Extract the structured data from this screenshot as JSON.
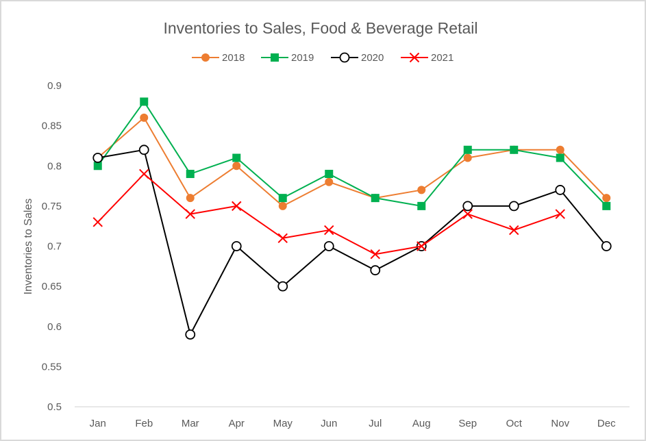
{
  "chart_data": {
    "type": "line",
    "title": "Inventories to Sales, Food & Beverage Retail",
    "xlabel": "",
    "ylabel": "Inventories to Sales",
    "categories": [
      "Jan",
      "Feb",
      "Mar",
      "Apr",
      "May",
      "Jun",
      "Jul",
      "Aug",
      "Sep",
      "Oct",
      "Nov",
      "Dec"
    ],
    "ylim": [
      0.5,
      0.9
    ],
    "yticks": [
      0.5,
      0.55,
      0.6,
      0.65,
      0.7,
      0.75,
      0.8,
      0.85,
      0.9
    ],
    "ytick_labels": [
      "0.5",
      "0.55",
      "0.6",
      "0.65",
      "0.7",
      "0.75",
      "0.8",
      "0.85",
      "0.9"
    ],
    "grid": false,
    "legend_position": "top-center",
    "series": [
      {
        "name": "2018",
        "color": "#ed7d31",
        "marker": "circle",
        "values": [
          0.81,
          0.86,
          0.76,
          0.8,
          0.75,
          0.78,
          0.76,
          0.77,
          0.81,
          0.82,
          0.82,
          0.76
        ]
      },
      {
        "name": "2019",
        "color": "#00b050",
        "marker": "square",
        "values": [
          0.8,
          0.88,
          0.79,
          0.81,
          0.76,
          0.79,
          0.76,
          0.75,
          0.82,
          0.82,
          0.81,
          0.75
        ]
      },
      {
        "name": "2020",
        "color": "#000000",
        "marker": "open-circle",
        "values": [
          0.81,
          0.82,
          0.59,
          0.7,
          0.65,
          0.7,
          0.67,
          0.7,
          0.75,
          0.75,
          0.77,
          0.7
        ]
      },
      {
        "name": "2021",
        "color": "#ff0000",
        "marker": "x",
        "values": [
          0.73,
          0.79,
          0.74,
          0.75,
          0.71,
          0.72,
          0.69,
          0.7,
          0.74,
          0.72,
          0.74,
          null
        ]
      }
    ]
  }
}
